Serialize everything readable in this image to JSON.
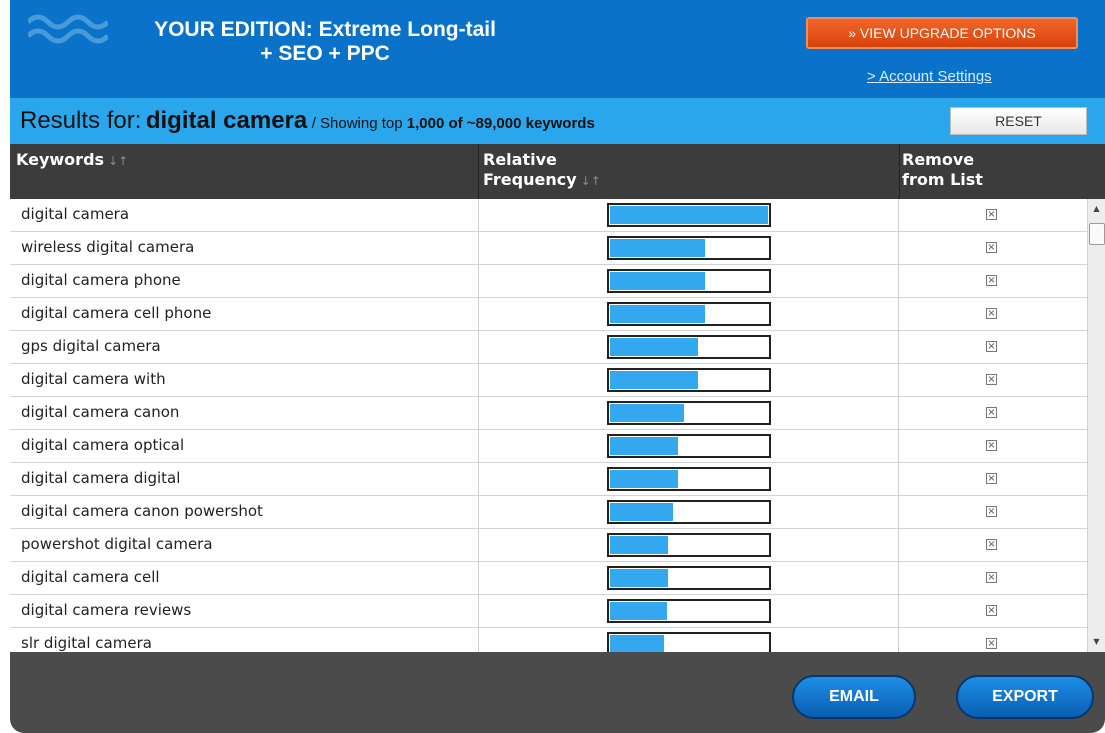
{
  "header": {
    "edition_line1": "YOUR EDITION: Extreme Long-tail",
    "edition_line2": "+ SEO + PPC",
    "upgrade_label": "» VIEW UPGRADE OPTIONS",
    "account_link": "> Account Settings"
  },
  "results": {
    "prefix": "Results for:",
    "query": "digital camera",
    "showing_prefix": "/ Showing top",
    "showing_count": "1,000 of ~89,000 keywords",
    "reset_label": "RESET"
  },
  "table": {
    "columns": {
      "keywords": "Keywords",
      "freq_line1": "Relative",
      "freq_line2": "Frequency",
      "remove_line1": "Remove",
      "remove_line2": "from List",
      "sort_glyph": "↓↑"
    },
    "rows": [
      {
        "keyword": "digital camera",
        "freq": 1.0
      },
      {
        "keyword": "wireless digital camera",
        "freq": 0.6
      },
      {
        "keyword": "digital camera phone",
        "freq": 0.6
      },
      {
        "keyword": "digital camera cell phone",
        "freq": 0.6
      },
      {
        "keyword": "gps digital camera",
        "freq": 0.56
      },
      {
        "keyword": "digital camera with",
        "freq": 0.56
      },
      {
        "keyword": "digital camera canon",
        "freq": 0.47
      },
      {
        "keyword": "digital camera optical",
        "freq": 0.43
      },
      {
        "keyword": "digital camera digital",
        "freq": 0.43
      },
      {
        "keyword": "digital camera canon powershot",
        "freq": 0.4
      },
      {
        "keyword": "powershot digital camera",
        "freq": 0.37
      },
      {
        "keyword": "digital camera cell",
        "freq": 0.37
      },
      {
        "keyword": "digital camera reviews",
        "freq": 0.36
      },
      {
        "keyword": "slr digital camera",
        "freq": 0.34
      }
    ]
  },
  "footer": {
    "email_label": "EMAIL",
    "export_label": "EXPORT"
  },
  "colors": {
    "header_bg": "#0a73c9",
    "results_bar_bg": "#2aa7ec",
    "upgrade_orange": "#e0501a",
    "bar_fill": "#33a8ee",
    "table_header_bg": "#3c3c3c",
    "footer_bg": "#4b4b4b"
  }
}
